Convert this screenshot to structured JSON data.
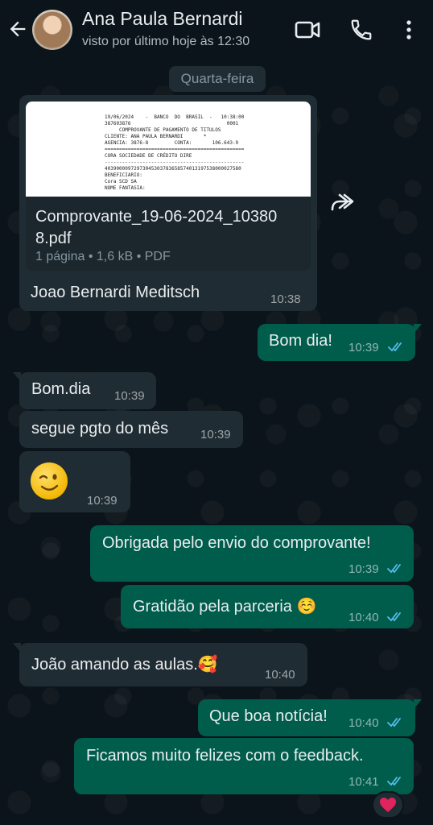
{
  "header": {
    "contact_name": "Ana Paula Bernardi",
    "status": "visto por último hoje às 12:30",
    "icons": [
      "back-arrow-icon",
      "video-call-icon",
      "phone-icon",
      "more-options-icon"
    ]
  },
  "date_separator": "Quarta-feira",
  "document_message": {
    "preview_lines": [
      "19/06/2024    -  BANCO  DO  BRASIL  -   10:38:00",
      "387603876                                 0001",
      "     COMPROVANTE DE PAGAMENTO DE TITULOS",
      "CLIENTE: ANA PAULA BERNARDI       *",
      "AGENCIA: 3876-8         CONTA:       106.643-9",
      "================================================",
      "CORA SOCIEDADE DE CRÉDITO DIRE",
      "------------------------------------------------",
      "40390000972973045303783658574013197538000027580",
      "BENEFICIARIO:",
      "Cora SCD SA",
      "NOME FANTASIA:"
    ],
    "filename": "Comprovante_19-06-2024_103808.pdf",
    "filename_line1": "Comprovante_19-06-2024_10380",
    "filename_line2": "8.pdf",
    "meta": "1 página • 1,6 kB • PDF",
    "caption": "Joao Bernardi Meditsch",
    "time": "10:38"
  },
  "messages": [
    {
      "direction": "out",
      "text": "Bom dia!",
      "time": "10:39"
    },
    {
      "direction": "in",
      "text": "Bom.dia",
      "time": "10:39"
    },
    {
      "direction": "in",
      "text": "segue pgto do mês",
      "time": "10:39"
    },
    {
      "direction": "in",
      "text": "😉",
      "time": "10:39"
    },
    {
      "direction": "out",
      "text": "Obrigada pelo envio do comprovante!",
      "time": "10:39"
    },
    {
      "direction": "out",
      "text": "Gratidão pela parceria ☺️",
      "time": "10:40"
    },
    {
      "direction": "in",
      "text": "João  amando as aulas.🥰",
      "time": "10:40"
    },
    {
      "direction": "out",
      "text": "Que boa notícia!",
      "time": "10:40"
    },
    {
      "direction": "out",
      "text": "Ficamos muito felizes com o feedback.",
      "time": "10:41"
    }
  ],
  "reaction": "❤️",
  "colors": {
    "background": "#0b141a",
    "incoming_bubble": "#202c33",
    "outgoing_bubble": "#005c4b",
    "read_ticks": "#53bdeb"
  }
}
